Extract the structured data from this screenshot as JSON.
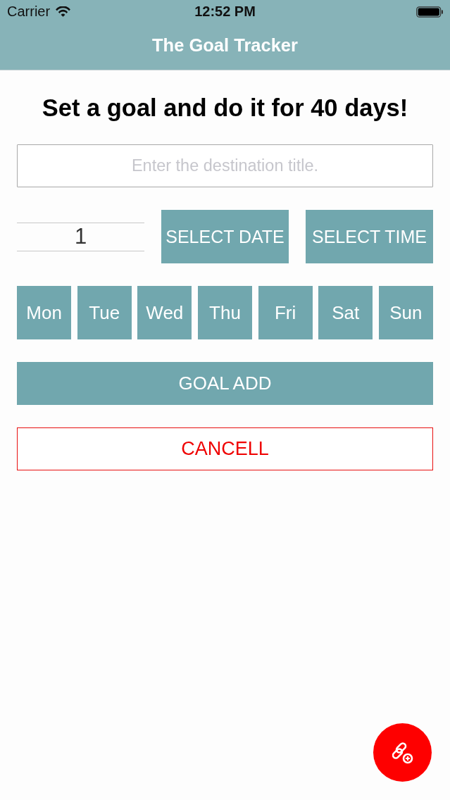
{
  "status_bar": {
    "carrier": "Carrier",
    "time": "12:52 PM"
  },
  "nav_bar": {
    "title": "The Goal Tracker"
  },
  "heading": "Set a goal and do it for 40 days!",
  "title_field": {
    "placeholder": "Enter the destination title."
  },
  "count_field": {
    "value": "1"
  },
  "select_buttons": [
    {
      "label": "SELECT DATE"
    },
    {
      "label": "SELECT TIME"
    }
  ],
  "days": [
    {
      "label": "Mon"
    },
    {
      "label": "Tue"
    },
    {
      "label": "Wed"
    },
    {
      "label": "Thu"
    },
    {
      "label": "Fri"
    },
    {
      "label": "Sat"
    },
    {
      "label": "Sun"
    }
  ],
  "actions": [
    {
      "kind": "primary",
      "label": "GOAL ADD"
    },
    {
      "kind": "cancel",
      "label": "CANCELL"
    }
  ]
}
